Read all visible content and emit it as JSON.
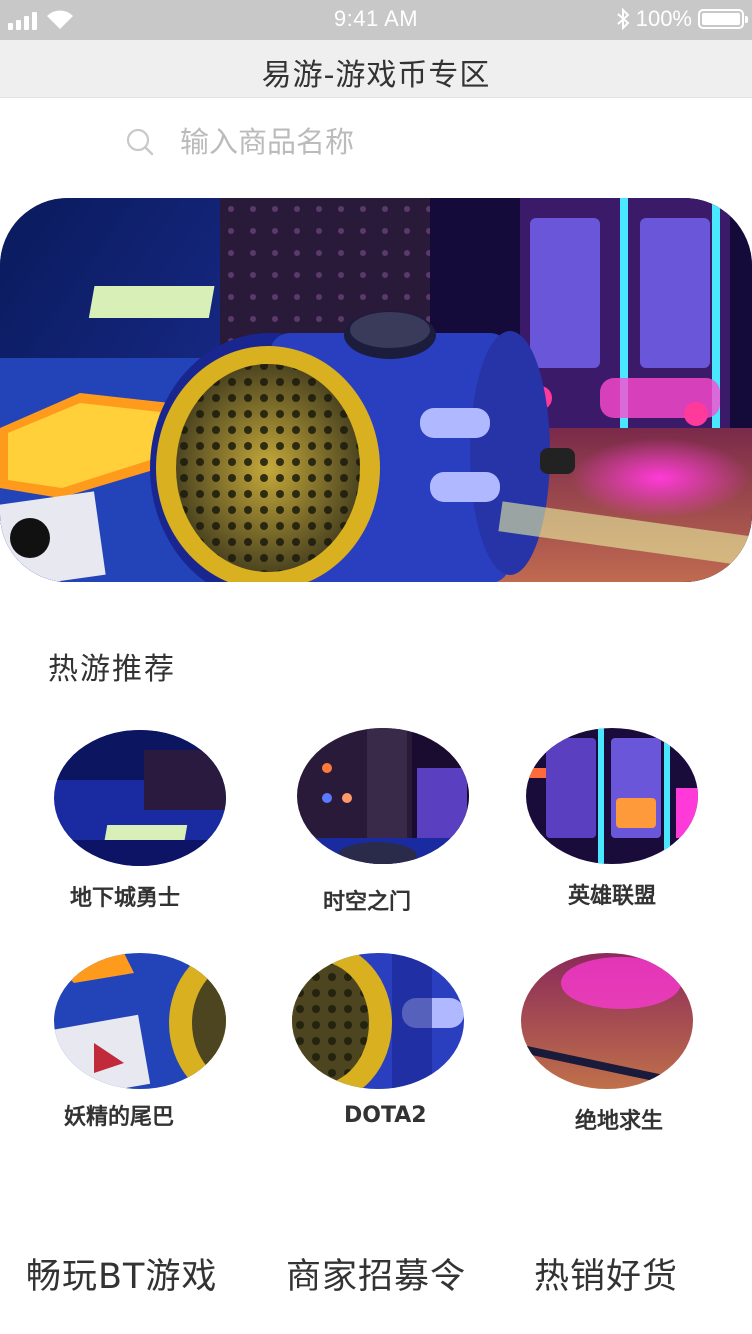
{
  "status_bar": {
    "time": "9:41 AM",
    "battery": "100%",
    "icons": [
      "signal-icon",
      "wifi-icon",
      "bluetooth-icon",
      "battery-icon"
    ]
  },
  "header": {
    "title": "易游-游戏币专区"
  },
  "search": {
    "placeholder": "输入商品名称",
    "value": ""
  },
  "hot": {
    "title": "热游推荐",
    "games": [
      {
        "name": "地下城勇士"
      },
      {
        "name": "时空之门"
      },
      {
        "name": "英雄联盟"
      },
      {
        "name": "妖精的尾巴"
      },
      {
        "name": "DOTA2"
      },
      {
        "name": "绝地求生"
      }
    ]
  },
  "bottom_nav": {
    "items": [
      {
        "label": "畅玩BT游戏"
      },
      {
        "label": "商家招募令"
      },
      {
        "label": "热销好货"
      }
    ]
  },
  "colors": {
    "status_bar_bg": "#c8c8c8",
    "nav_bar_bg": "#efefef",
    "text_main": "#333333",
    "placeholder": "#bbbbbb"
  }
}
